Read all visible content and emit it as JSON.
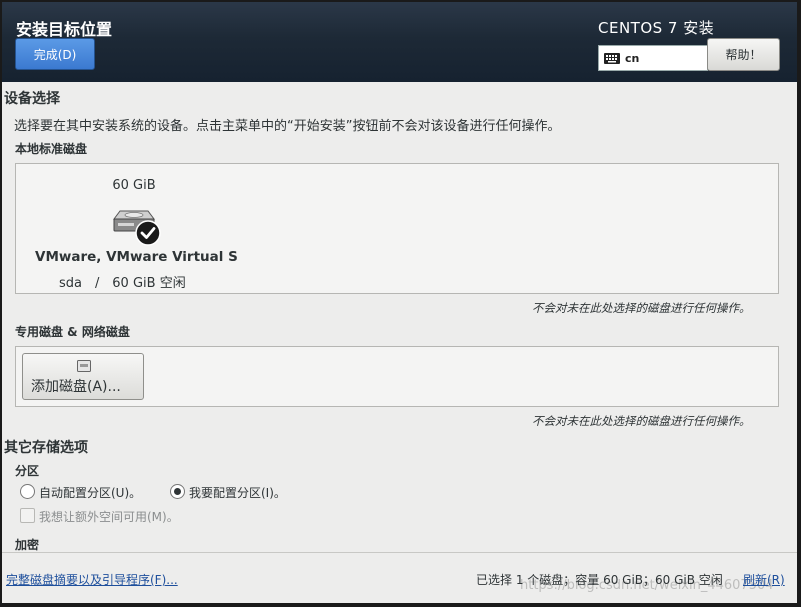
{
  "header": {
    "title": "安装目标位置",
    "done_button": "完成(D)",
    "product": "CENTOS 7 安装",
    "keyboard_layout": "cn",
    "help_button": "帮助！"
  },
  "device_selection": {
    "title": "设备选择",
    "description": "选择要在其中安装系统的设备。点击主菜单中的“开始安装”按钮前不会对该设备进行任何操作。",
    "local_disks_title": "本地标准磁盘",
    "disks": [
      {
        "size": "60 GiB",
        "name": "VMware, VMware Virtual S",
        "device": "sda",
        "separator": "/",
        "free": "60 GiB 空闲",
        "selected": true
      }
    ],
    "local_note": "不会对未在此处选择的磁盘进行任何操作。",
    "special_disks_title": "专用磁盘 & 网络磁盘",
    "add_disk_button": "添加磁盘(A)...",
    "special_note": "不会对未在此处选择的磁盘进行任何操作。"
  },
  "other_storage": {
    "title": "其它存储选项",
    "partition_title": "分区",
    "auto_partition": "自动配置分区(U)。",
    "manual_partition": "我要配置分区(I)。",
    "selected_option": "manual",
    "extra_space": "我想让额外空间可用(M)。",
    "encryption_title": "加密"
  },
  "footer": {
    "summary_link": "完整磁盘摘要以及引导程序(F)...",
    "status": "已选择 1 个磁盘；容量 60 GiB；60 GiB 空闲",
    "refresh_link": "刷新(R)",
    "watermark": "https://blog.csdn.net/weixin_44607504"
  },
  "colors": {
    "header_bg": "#1d2936",
    "accent_button": "#3b79d0",
    "link": "#1e4f9c",
    "content_bg": "#ededec"
  }
}
